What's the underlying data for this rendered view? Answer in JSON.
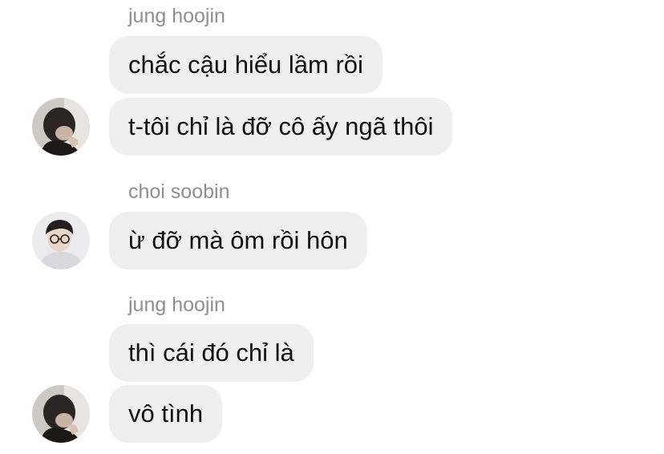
{
  "chat": {
    "groups": [
      {
        "sender": "jung hoojin",
        "avatar": "avatar-jung-hoojin",
        "messages": [
          "chắc cậu hiểu lầm rồi",
          "t-tôi chỉ là đỡ cô ấy ngã thôi"
        ]
      },
      {
        "sender": "choi soobin",
        "avatar": "avatar-choi-soobin",
        "messages": [
          "ừ đỡ mà ôm rồi hôn"
        ]
      },
      {
        "sender": "jung hoojin",
        "avatar": "avatar-jung-hoojin",
        "messages": [
          "thì cái đó chỉ là",
          "vô tình"
        ]
      }
    ]
  },
  "colors": {
    "bubble_background": "#efeff0",
    "sender_name": "#8e8e93",
    "message_text": "#111111"
  }
}
